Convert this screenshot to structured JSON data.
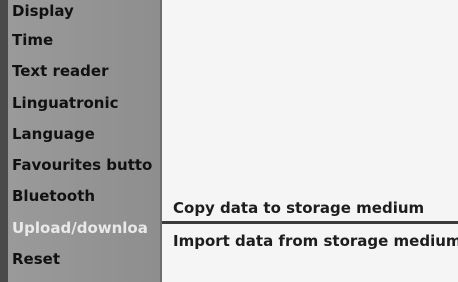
{
  "left_menu": {
    "items": [
      {
        "label": "Display",
        "selected": false
      },
      {
        "label": "Time",
        "selected": false
      },
      {
        "label": "Text reader",
        "selected": false
      },
      {
        "label": "Linguatronic",
        "selected": false
      },
      {
        "label": "Language",
        "selected": false
      },
      {
        "label": "Favourites butto",
        "selected": false
      },
      {
        "label": "Bluetooth",
        "selected": false
      },
      {
        "label": "Upload/downloa",
        "selected": true
      },
      {
        "label": "Reset",
        "selected": false
      }
    ]
  },
  "submenu": {
    "items": [
      {
        "label": "Copy data to storage medium"
      },
      {
        "label": "Import data from storage medium"
      }
    ]
  },
  "colors": {
    "menu_background": "#969696",
    "selected_text": "#e9e9e9",
    "content_background": "#f5f5f5",
    "divider": "#3b3b3b"
  }
}
